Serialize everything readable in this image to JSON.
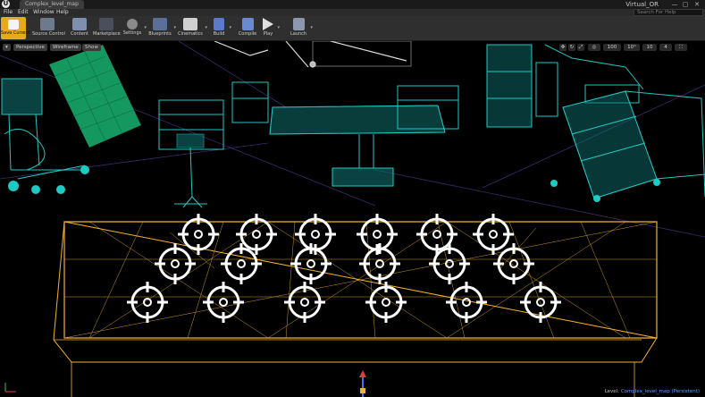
{
  "titlebar": {
    "logo": "U",
    "doc_tab": "Complex_level_map",
    "project": "Virtual_OR",
    "minimize": "—",
    "maximize": "▢",
    "close": "✕"
  },
  "menu": {
    "file": "File",
    "edit": "Edit",
    "window": "Window",
    "help": "Help",
    "search_placeholder": "Search For Help"
  },
  "toolbar": {
    "save": "Save Current",
    "source_control": "Source Control",
    "content": "Content",
    "marketplace": "Marketplace",
    "settings": "Settings",
    "blueprints": "Blueprints",
    "cinematics": "Cinematics",
    "build": "Build",
    "compile": "Compile",
    "play": "Play",
    "launch": "Launch"
  },
  "viewport": {
    "perspective": "Perspective",
    "wireframe": "Wireframe",
    "show": "Show",
    "grid_snap": "100",
    "rotate_snap": "10°",
    "scale_snap": "10",
    "camera_speed": "4",
    "level_prefix": "Level:",
    "level_name": "Complex_level_map (Persistent)"
  },
  "colors": {
    "accent": "#e9a81d",
    "equipment_wire": "#1fc9c4",
    "screen_wire": "#17a86a",
    "table_wire": "#f2b22a",
    "target_marker": "#ffffff"
  },
  "markers": {
    "rows": [
      6,
      6,
      6
    ],
    "total": 18
  }
}
